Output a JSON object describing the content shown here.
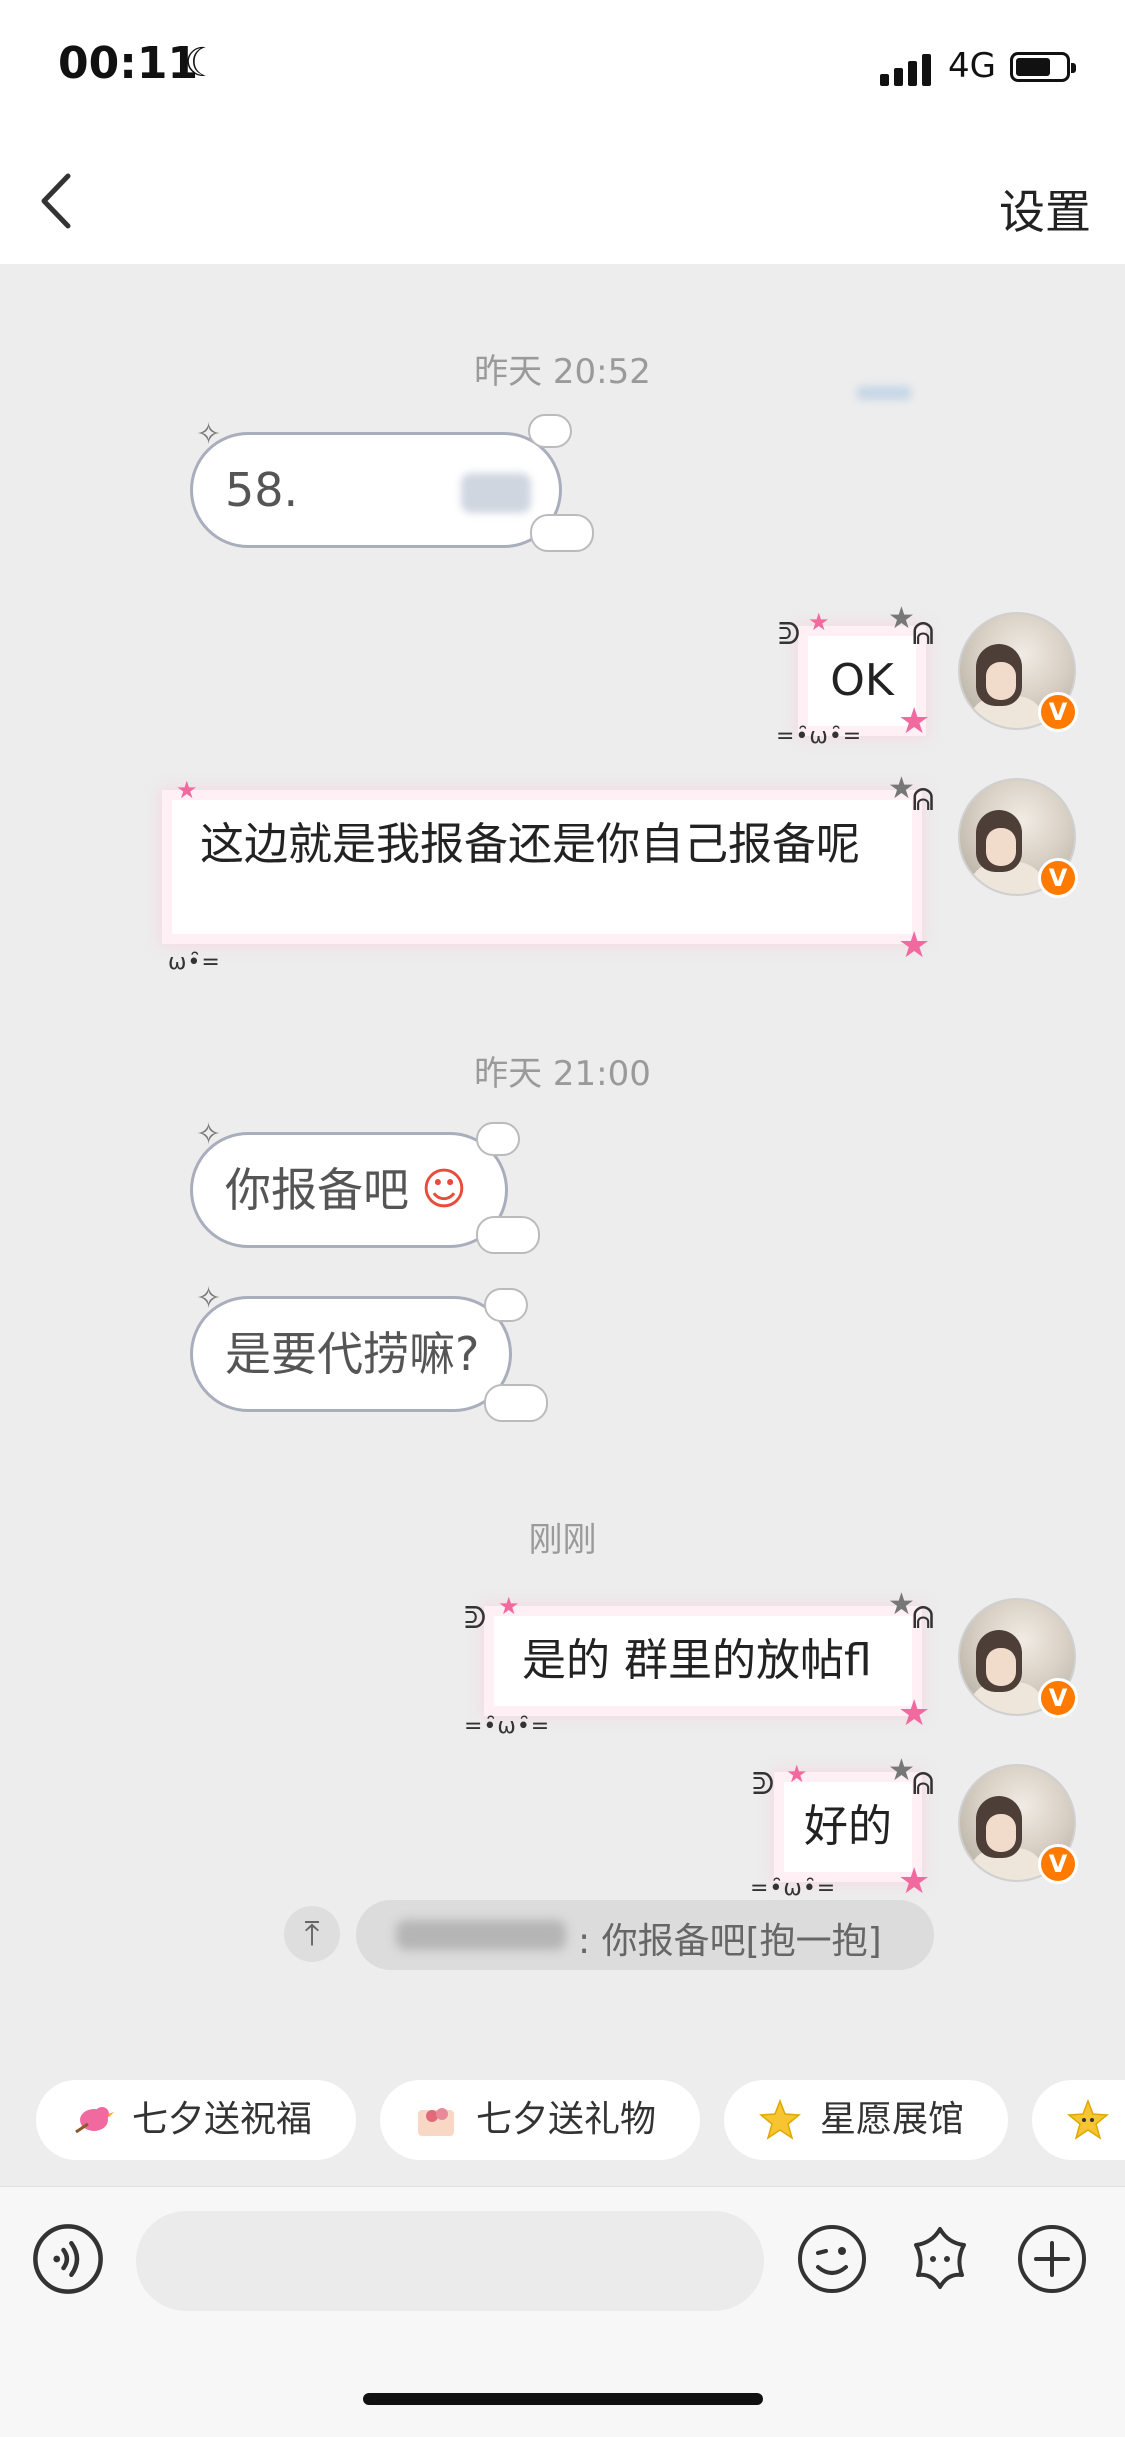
{
  "status_bar": {
    "time": "00:11",
    "network": "4G"
  },
  "header": {
    "settings_label": "设置"
  },
  "messages": [
    {
      "timestamp": "昨天 20:52"
    },
    {
      "side": "left",
      "text": "58."
    },
    {
      "side": "right",
      "text": "OK"
    },
    {
      "side": "right",
      "text": "这边就是我报备还是你自己报备呢"
    },
    {
      "timestamp": "昨天 21:00"
    },
    {
      "side": "left",
      "text": "你报备吧"
    },
    {
      "side": "left",
      "text": "是要代捞嘛?"
    },
    {
      "timestamp": "刚刚"
    },
    {
      "side": "right",
      "text": "是的 群里的放帖fl"
    },
    {
      "side": "right",
      "text": "好的"
    }
  ],
  "quote": {
    "text": ": 你报备吧[抱一抱]",
    "icon": "pin-top-icon"
  },
  "quick_chips": [
    {
      "label": "七夕送祝福",
      "icon": "bird-icon"
    },
    {
      "label": "七夕送礼物",
      "icon": "gift-envelope-icon"
    },
    {
      "label": "星愿展馆",
      "icon": "star-icon"
    },
    {
      "label": "",
      "icon": "star-face-icon"
    }
  ],
  "input": {
    "placeholder": ""
  },
  "colors": {
    "accent_badge": "#ff7a00",
    "background": "#ededed"
  }
}
